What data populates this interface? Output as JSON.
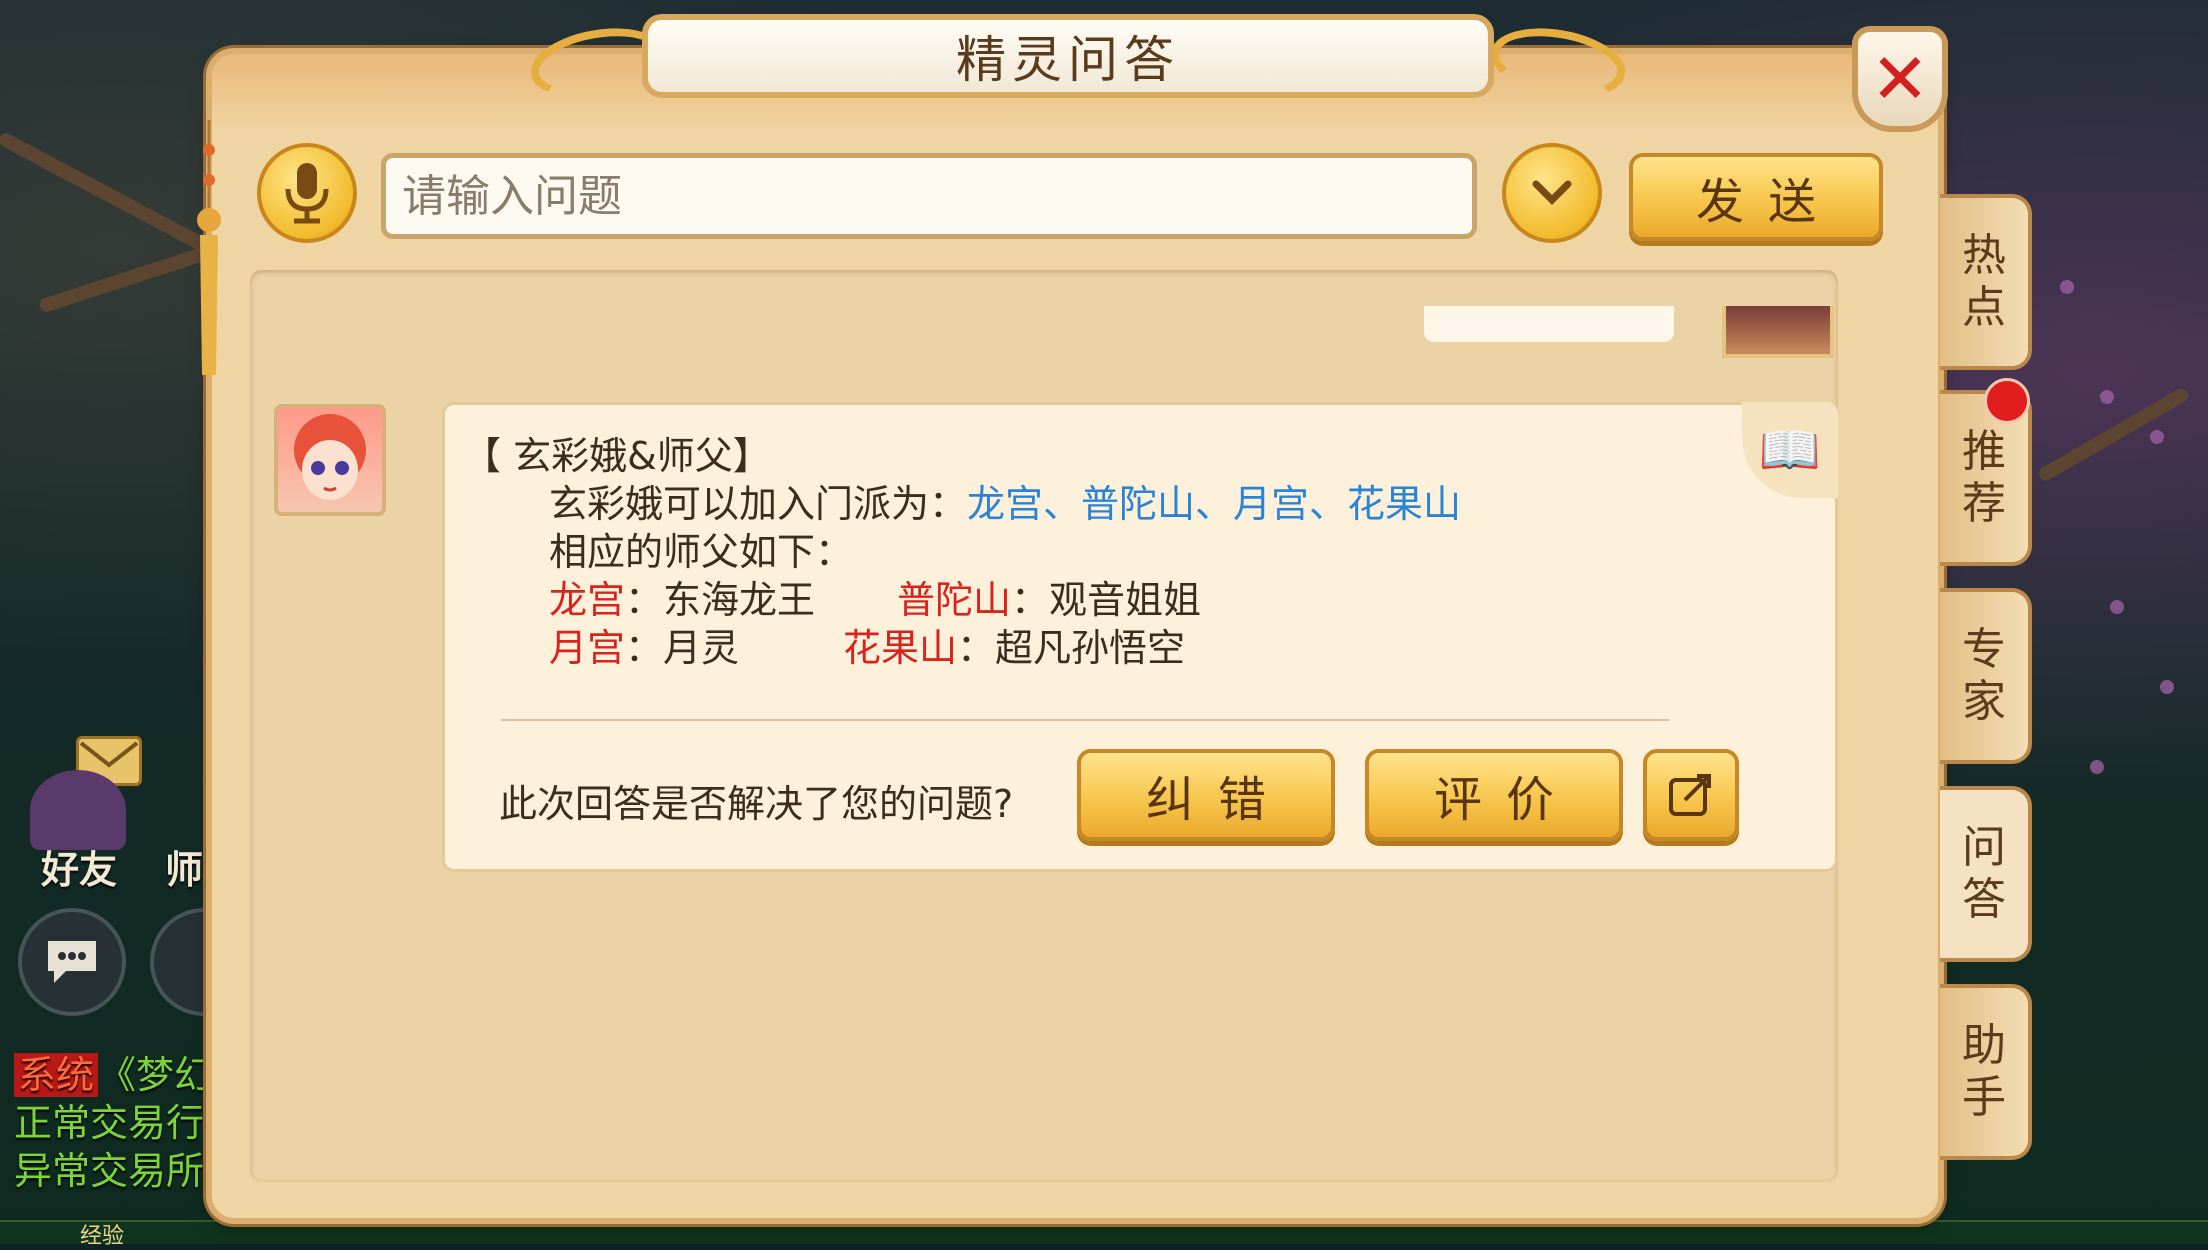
{
  "dialog": {
    "title": "精灵问答",
    "close_label": "✕"
  },
  "query_bar": {
    "input_placeholder": "请输入问题",
    "input_value": "",
    "send_label": "发送"
  },
  "answer": {
    "heading": "【 玄彩娥&师父】",
    "line1_prefix": "玄彩娥可以加入门派为：",
    "line1_schools": "龙宫、普陀山、月宫、花果山",
    "line2": "相应的师父如下：",
    "masters": [
      {
        "school": "龙宫",
        "sep": "：",
        "master": "东海龙王"
      },
      {
        "school": "普陀山",
        "sep": "：",
        "master": "观音姐姐"
      },
      {
        "school": "月宫",
        "sep": "：",
        "master": "月灵"
      },
      {
        "school": "花果山",
        "sep": "：",
        "master": "超凡孙悟空"
      }
    ],
    "feedback_question": "此次回答是否解决了您的问题?",
    "correct_label": "纠错",
    "rate_label": "评价"
  },
  "side_tabs": [
    {
      "label": "热点"
    },
    {
      "label": "推荐"
    },
    {
      "label": "专家"
    },
    {
      "label": "问答"
    },
    {
      "label": "助手"
    }
  ],
  "hud": {
    "friends_label": "好友",
    "master_label": "师",
    "chat_channel": "系统",
    "chat_lines": [
      "《梦幻",
      "正常交易行",
      "异常交易所"
    ],
    "exp_label": "经验"
  },
  "colors": {
    "link_blue": "#2a84d6",
    "school_red": "#d8241d",
    "gold": "#f7c64c"
  }
}
